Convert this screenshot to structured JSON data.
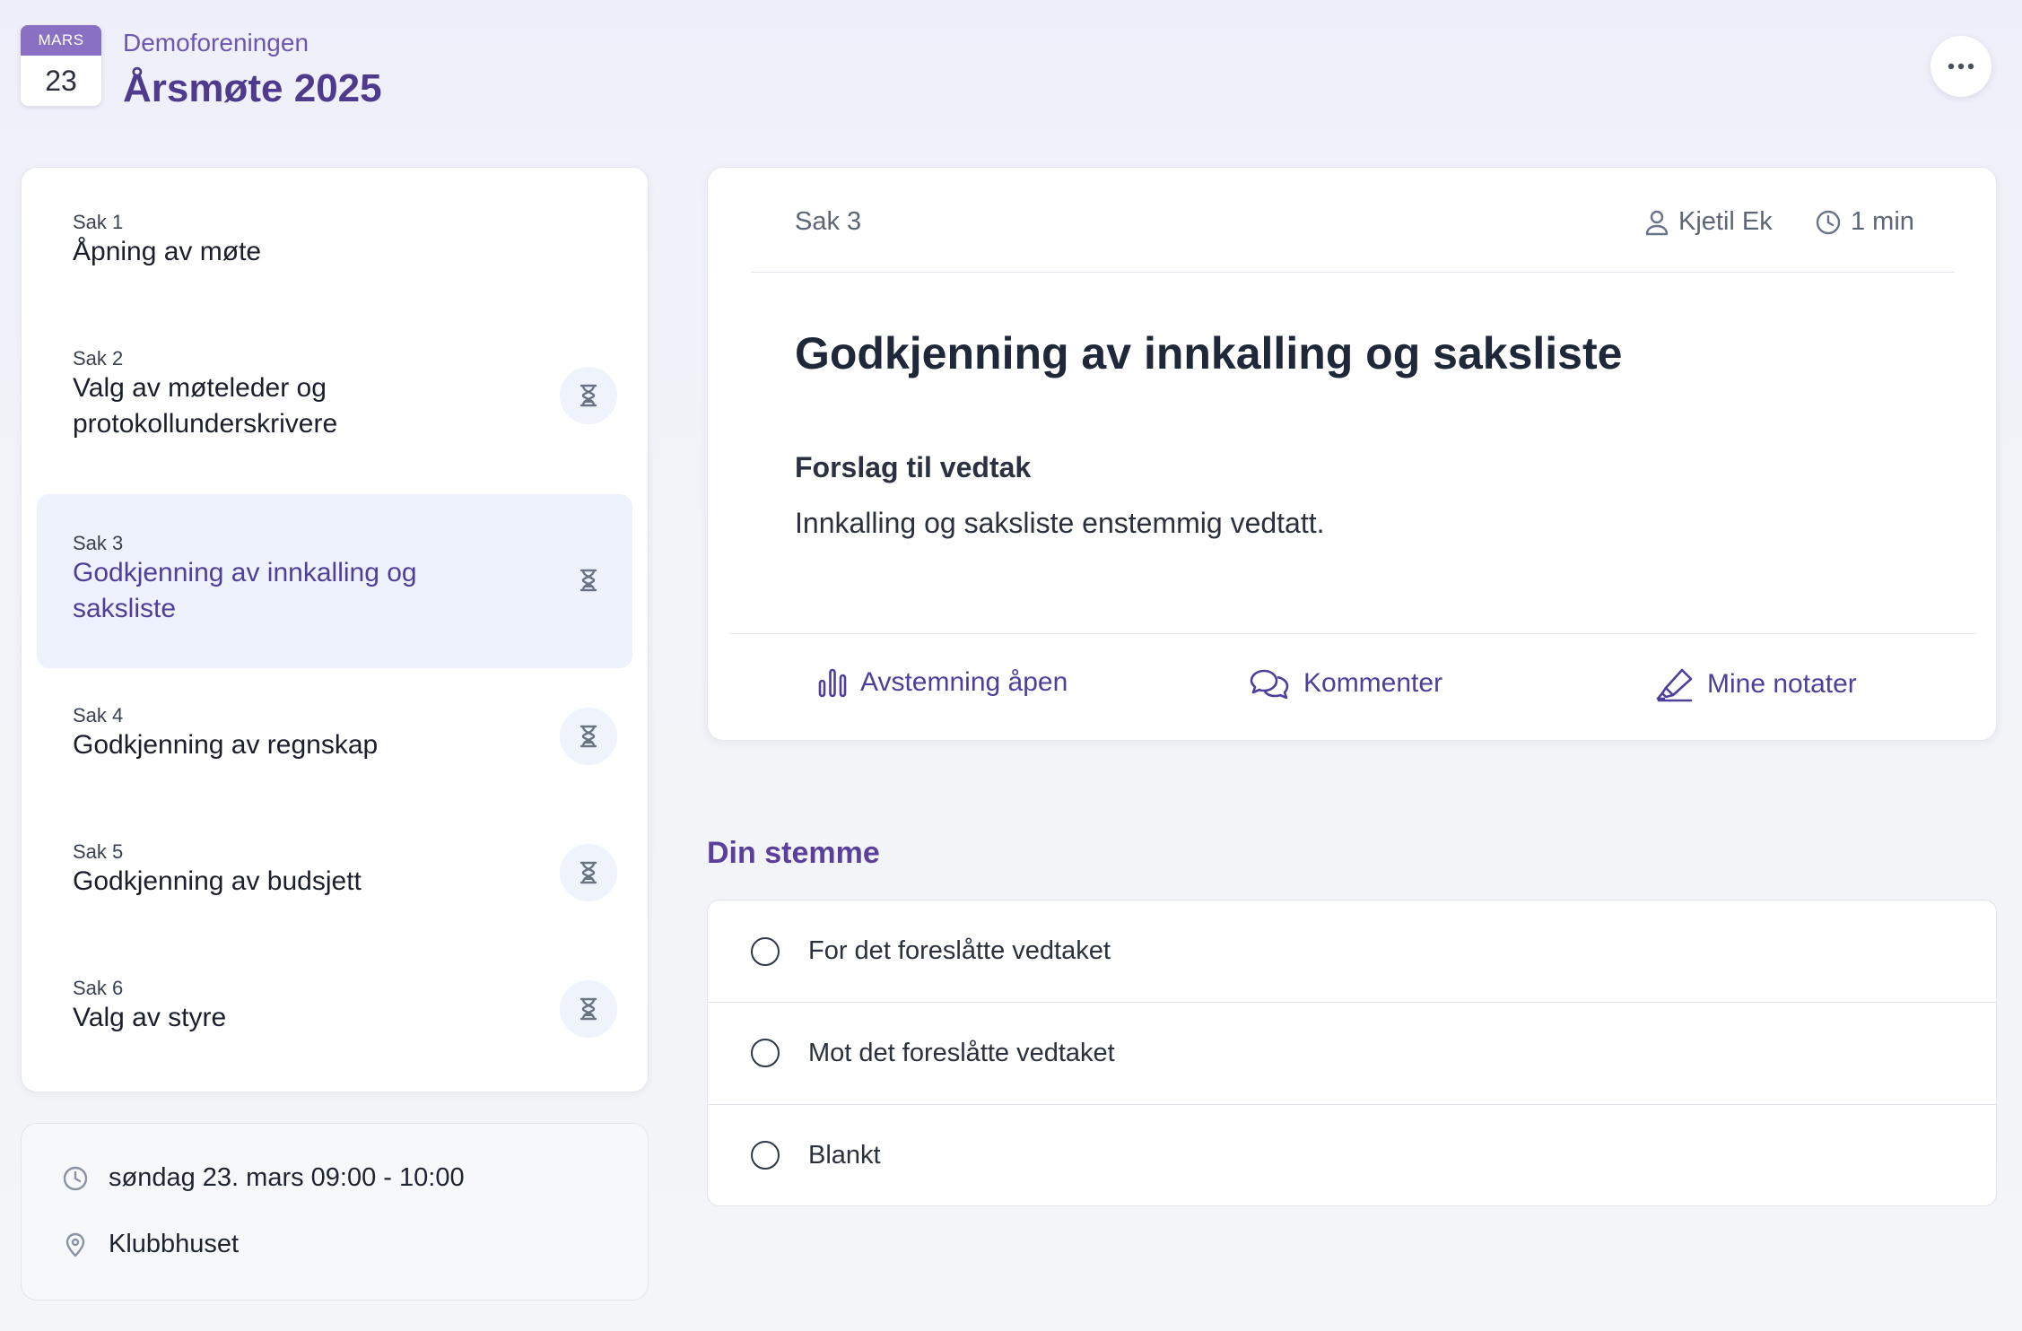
{
  "header": {
    "calendar_month": "MARS",
    "calendar_day": "23",
    "organization": "Demoforeningen",
    "title": "Årsmøte 2025"
  },
  "agenda": {
    "items": [
      {
        "number": "Sak 1",
        "title": "Åpning av møte",
        "status_icon": "none",
        "active": false
      },
      {
        "number": "Sak 2",
        "title": "Valg av møteleder og protokollunderskrivere",
        "status_icon": "hourglass-icon",
        "active": false
      },
      {
        "number": "Sak 3",
        "title": "Godkjenning av innkalling og saksliste",
        "status_icon": "hourglass-icon",
        "active": true
      },
      {
        "number": "Sak 4",
        "title": "Godkjenning av regnskap",
        "status_icon": "hourglass-icon",
        "active": false
      },
      {
        "number": "Sak 5",
        "title": "Godkjenning av budsjett",
        "status_icon": "hourglass-icon",
        "active": false
      },
      {
        "number": "Sak 6",
        "title": "Valg av styre",
        "status_icon": "hourglass-icon",
        "active": false
      }
    ]
  },
  "info": {
    "datetime": "søndag 23. mars 09:00 - 10:00",
    "location": "Klubbhuset"
  },
  "card": {
    "sak_label": "Sak 3",
    "presenter": "Kjetil Ek",
    "duration": "1 min",
    "heading": "Godkjenning av innkalling og saksliste",
    "proposal_label": "Forslag til vedtak",
    "proposal_text": "Innkalling og saksliste enstemmig vedtatt.",
    "actions": [
      {
        "label": "Avstemning åpen",
        "icon": "bar-chart-icon"
      },
      {
        "label": "Kommenter",
        "icon": "chat-bubbles-icon"
      },
      {
        "label": "Mine notater",
        "icon": "highlighter-pen-icon"
      }
    ]
  },
  "vote": {
    "heading": "Din stemme",
    "options": [
      {
        "label": "For det foreslåtte vedtaket",
        "selected": false
      },
      {
        "label": "Mot det foreslåtte vedtaket",
        "selected": false
      },
      {
        "label": "Blankt",
        "selected": false
      }
    ]
  },
  "colors": {
    "accent": "#4f3e9a",
    "calendar_header": "#8a70c3",
    "active_item_bg": "#edf2fd"
  }
}
